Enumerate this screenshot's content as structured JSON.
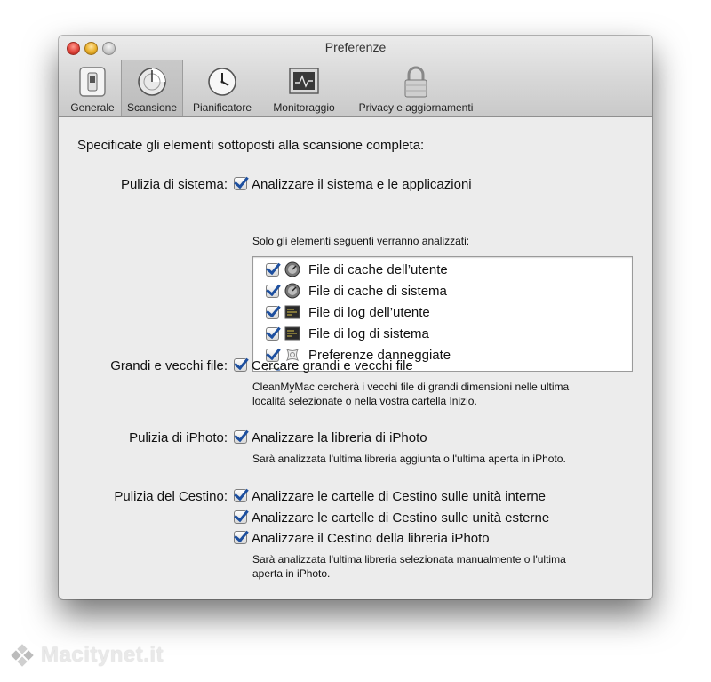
{
  "window": {
    "title": "Preferenze"
  },
  "toolbar": {
    "items": [
      {
        "label": "Generale",
        "icon": "switch-icon"
      },
      {
        "label": "Scansione",
        "icon": "scan-disc-icon"
      },
      {
        "label": "Pianificatore",
        "icon": "clock-icon"
      },
      {
        "label": "Monitoraggio",
        "icon": "monitor-icon"
      },
      {
        "label": "Privacy e aggiornamenti",
        "icon": "lock-icon"
      }
    ],
    "active": "Scansione"
  },
  "main": {
    "intro": "Specificate gli elementi sottoposti alla scansione completa:",
    "system": {
      "label": "Pulizia di sistema:",
      "option": "Analizzare il sistema e le applicazioni",
      "note": "Solo gli elementi seguenti verranno analizzati:",
      "items": [
        {
          "label": "File di cache dell’utente",
          "icon": "cache-gauge-icon",
          "checked": true
        },
        {
          "label": "File di cache di sistema",
          "icon": "cache-gauge-icon",
          "checked": true
        },
        {
          "label": "File di log dell’utente",
          "icon": "log-console-icon",
          "checked": true
        },
        {
          "label": "File di log di sistema",
          "icon": "log-console-icon",
          "checked": true
        },
        {
          "label": "Preferenze danneggiate",
          "icon": "broken-prefs-icon",
          "checked": true
        }
      ]
    },
    "large_files": {
      "label": "Grandi e vecchi file:",
      "option": "Cercare grandi e vecchi file",
      "note_line1": "CleanMyMac cercherà i vecchi file di grandi dimensioni nelle ultima",
      "note_line2": "località selezionate o nella vostra cartella Inizio."
    },
    "iphoto": {
      "label": "Pulizia di iPhoto:",
      "option": "Analizzare la libreria di iPhoto",
      "note": "Sarà analizzata l'ultima libreria aggiunta o l'ultima aperta in iPhoto."
    },
    "trash": {
      "label": "Pulizia del Cestino:",
      "options": [
        "Analizzare le cartelle di Cestino sulle unità interne",
        "Analizzare le cartelle di Cestino sulle unità esterne",
        "Analizzare il Cestino della libreria iPhoto"
      ],
      "note_line1": "Sarà analizzata l'ultima libreria selezionata manualmente o l'ultima",
      "note_line2": "aperta in iPhoto."
    }
  },
  "watermark": {
    "text": "Macitynet.it"
  },
  "colors": {
    "check": "#1d4f9f",
    "window_bg": "#ececec"
  }
}
